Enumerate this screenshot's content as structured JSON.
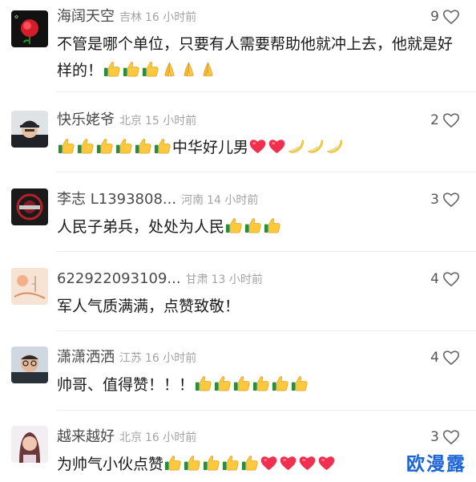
{
  "comments": [
    {
      "name": "海阔天空",
      "location": "吉林",
      "time": "16 小时前",
      "likes": "9",
      "text": "不管是哪个单位，只要有人需要帮助他就冲上去，他就是好样的！",
      "emojis": [
        "thumbs-up",
        "thumbs-up",
        "thumbs-up",
        "praying-hands",
        "praying-hands",
        "praying-hands"
      ],
      "avatar": "rose-avatar"
    },
    {
      "name": "快乐姥爷",
      "location": "北京",
      "time": "15 小时前",
      "likes": "2",
      "text_pre_emojis": [
        "thumbs-up",
        "thumbs-up",
        "thumbs-up",
        "thumbs-up",
        "thumbs-up",
        "thumbs-up"
      ],
      "text": "中华好儿男",
      "emojis": [
        "red-heart",
        "red-heart",
        "banana",
        "banana",
        "banana"
      ],
      "avatar": "man-cap-avatar"
    },
    {
      "name": "李志 L1393808...",
      "location": "河南",
      "time": "14 小时前",
      "likes": "3",
      "text": "人民子弟兵，处处为人民",
      "emojis": [
        "thumbs-up",
        "thumbs-up",
        "thumbs-up"
      ],
      "avatar": "dark-emblem-avatar"
    },
    {
      "name": "622922093109...",
      "location": "甘肃",
      "time": "13 小时前",
      "likes": "4",
      "text": "军人气质满满，点赞致敬！",
      "emojis": [],
      "avatar": "peach-art-avatar"
    },
    {
      "name": "潇潇洒洒",
      "location": "江苏",
      "time": "16 小时前",
      "likes": "4",
      "text": "帅哥、值得赞！！！",
      "emojis": [
        "thumbs-up",
        "thumbs-up",
        "thumbs-up",
        "thumbs-up",
        "thumbs-up",
        "thumbs-up"
      ],
      "avatar": "man-glasses-avatar"
    },
    {
      "name": "越来越好",
      "location": "北京",
      "time": "16 小时前",
      "likes": "3",
      "text": "为帅气小伙点赞",
      "emojis": [
        "thumbs-up",
        "thumbs-up",
        "thumbs-up",
        "thumbs-up",
        "thumbs-up",
        "red-heart",
        "red-heart",
        "red-heart",
        "red-heart"
      ],
      "avatar": "woman-avatar"
    }
  ],
  "watermark": "欧漫露",
  "colors": {
    "name": "#4a4a4a",
    "meta": "#a3a3a3",
    "text": "#1a1a1a",
    "watermark": "#1a63d8"
  }
}
